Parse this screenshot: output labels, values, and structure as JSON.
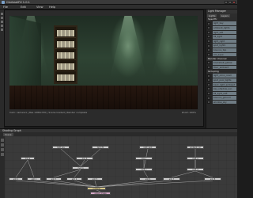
{
  "titlebar": {
    "title": "ClarisseiFX 1.0.1"
  },
  "menu": {
    "items": [
      "File",
      "Edit",
      "View",
      "Help"
    ]
  },
  "viewport": {
    "status_left": "Cam: camera1  |  Res 1280x720  |  Scene loaded  |  Render complete",
    "status_right": "Zoom 100%"
  },
  "right_panel": {
    "title": "Light Manager",
    "tabs": [
      "Lights",
      "Layers"
    ],
    "sections": [
      {
        "title": "Specific",
        "items": [
          "light_key",
          "ambient_lights",
          "light_left",
          "fill_light",
          "light_right",
          "spot_light1",
          "bounce_top",
          "rim_back"
        ]
      },
      {
        "title": "Render channel",
        "items": [
          "bookshelf_global",
          "floor_ambient"
        ]
      },
      {
        "title": "Grouping",
        "items": [
          "light_omni_room",
          "spot_pool_lights",
          "back_light_ambient",
          "key_shadow_sun",
          "fill_light_soft",
          "bounce_ground",
          "window_sky"
        ]
      }
    ]
  },
  "graph": {
    "title": "Shading Graph",
    "tab": "Scene",
    "nodes": [
      {
        "label": "light_key"
      },
      {
        "label": "light_fill"
      },
      {
        "label": "light_spot"
      },
      {
        "label": "ambient_col"
      },
      {
        "label": "mix_a"
      },
      {
        "label": "mix_b"
      },
      {
        "label": "mix_c"
      },
      {
        "label": "mult_a"
      },
      {
        "label": "mult_b"
      },
      {
        "label": "mult_c"
      },
      {
        "label": "mult_d"
      },
      {
        "label": "add_1"
      },
      {
        "label": "add_2"
      },
      {
        "label": "add_3"
      },
      {
        "label": "add_4"
      },
      {
        "label": "add_5"
      },
      {
        "label": "add_6"
      },
      {
        "label": "add_7"
      },
      {
        "label": "add_8"
      },
      {
        "label": "combine"
      },
      {
        "label": "output_image"
      }
    ]
  }
}
